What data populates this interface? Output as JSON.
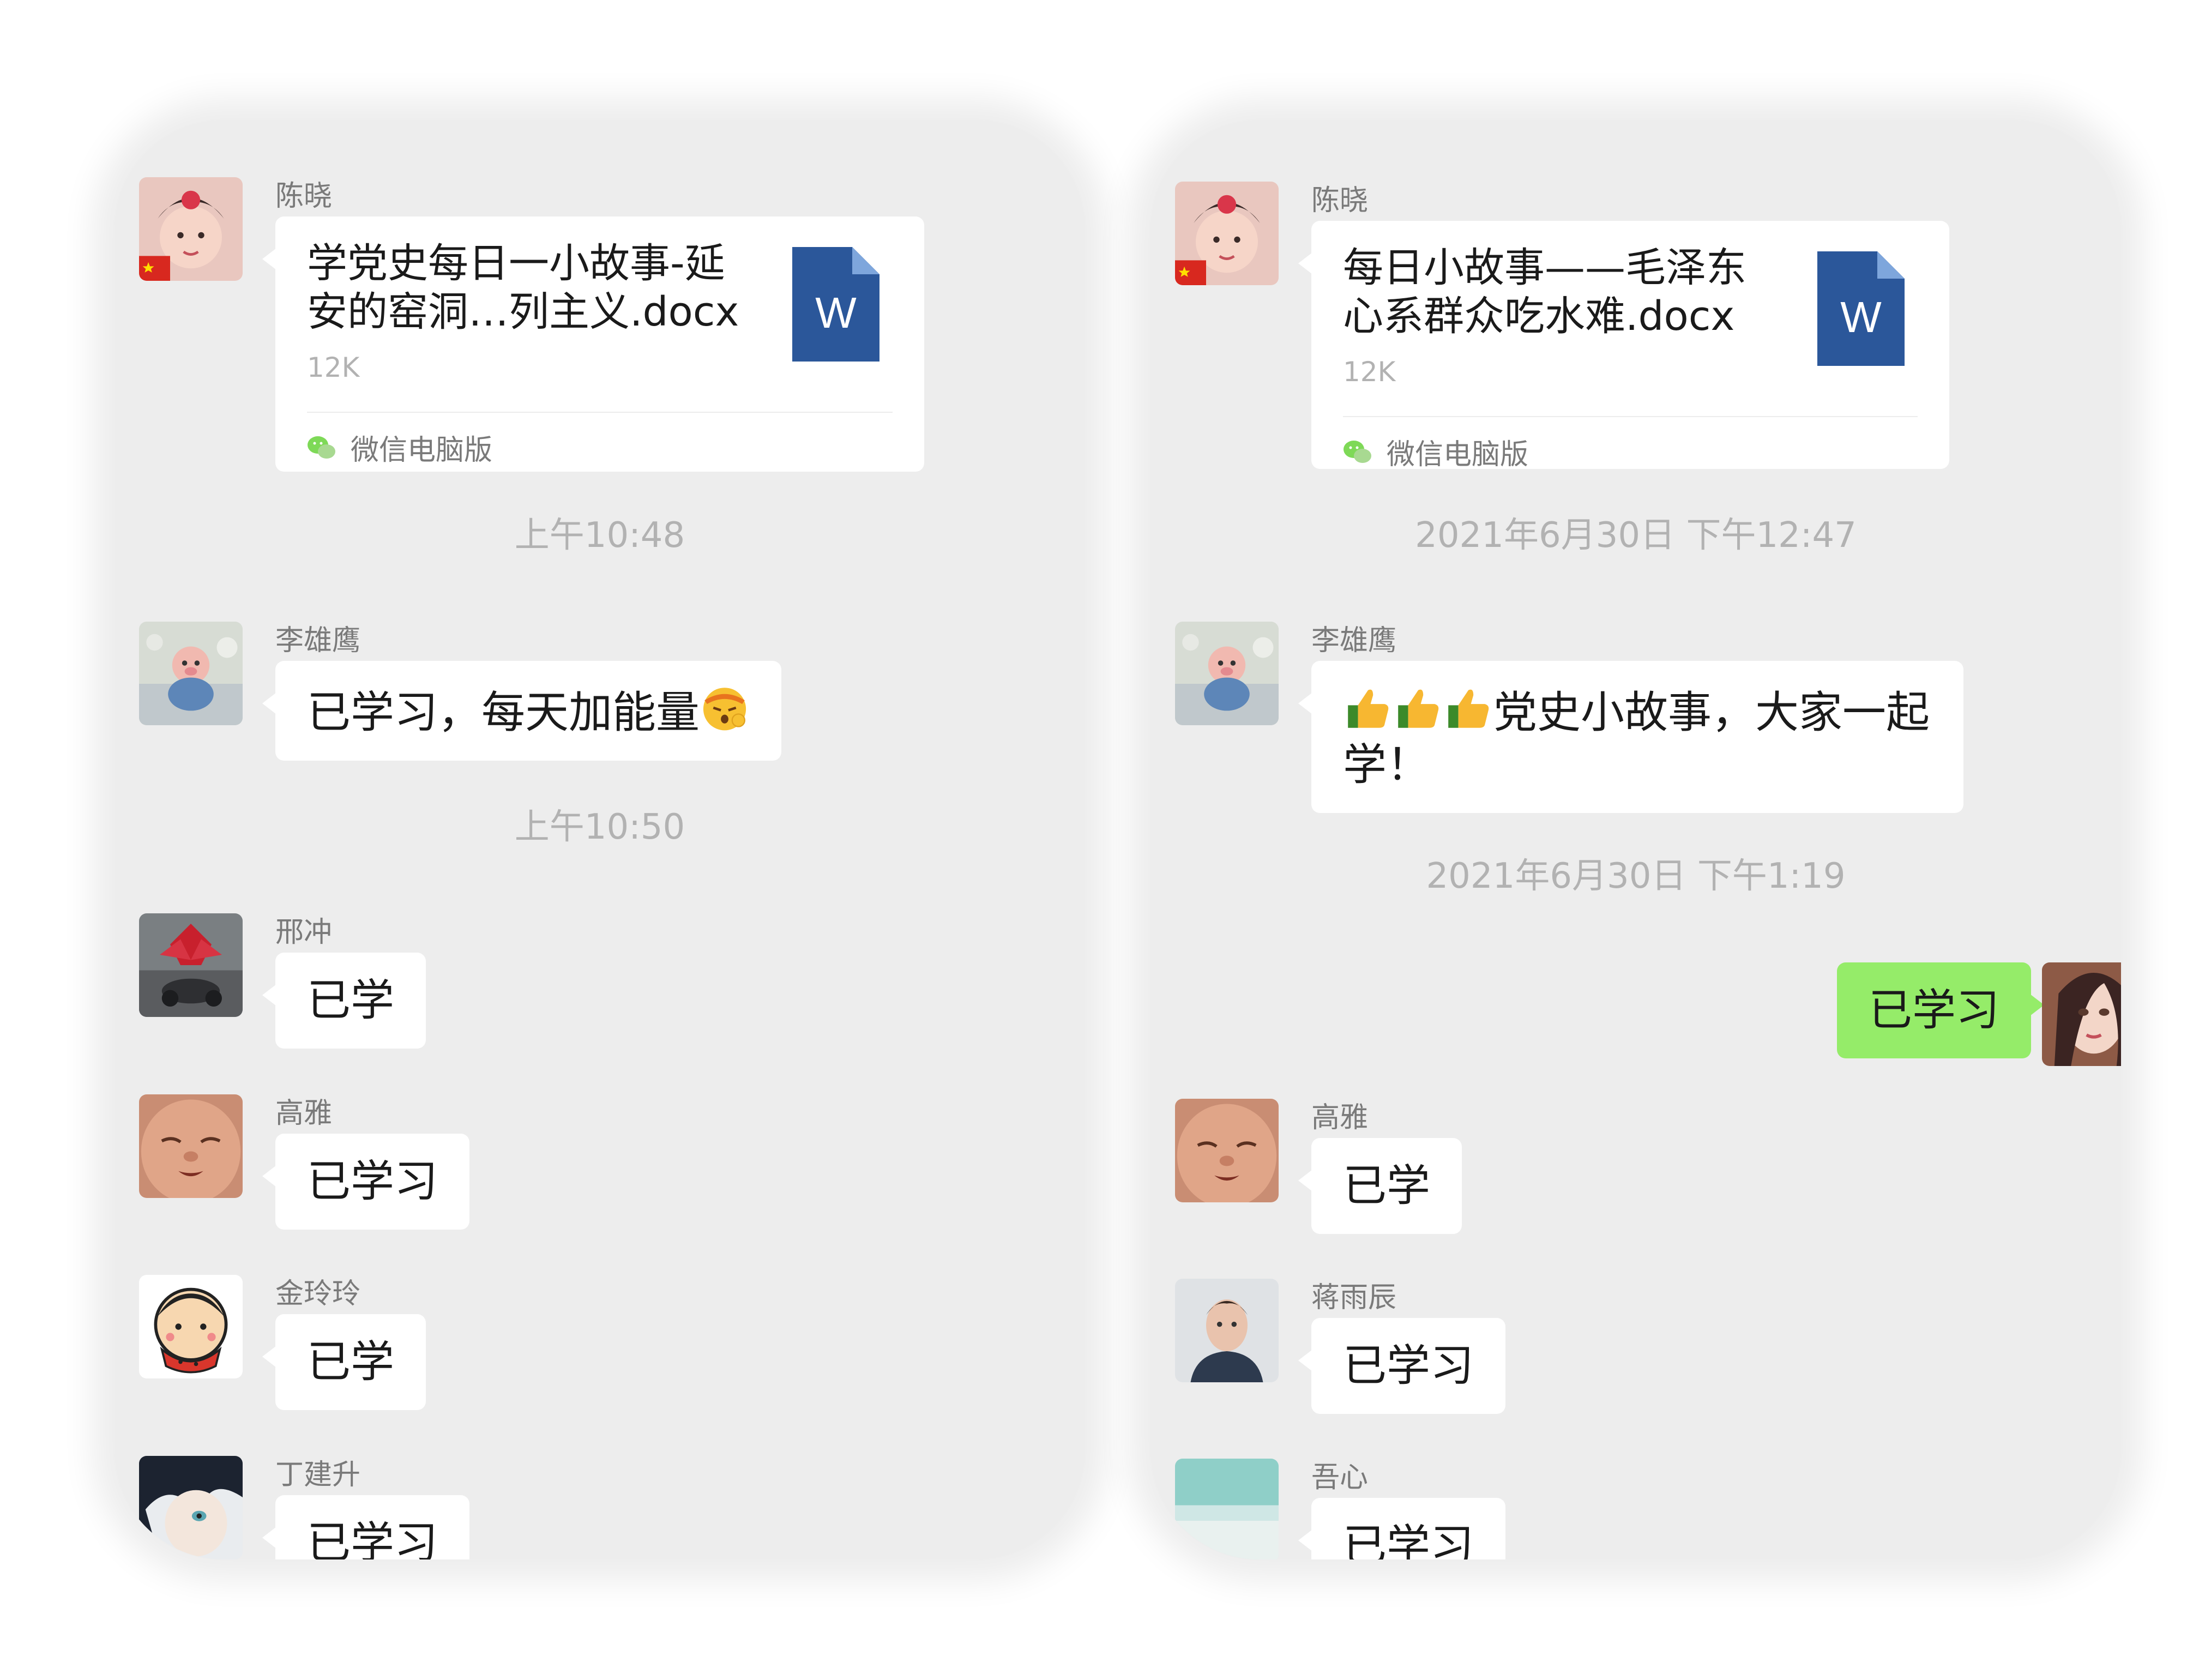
{
  "left_chat": {
    "file_message": {
      "sender": "陈晓",
      "file_name_line1": "学党史每日一小故事-延",
      "file_name_line2": "安的窑洞…列主义.docx",
      "file_size": "12K",
      "file_type_letter": "W",
      "source": "微信电脑版"
    },
    "timestamp_1": "上午10:48",
    "message_1": {
      "sender": "李雄鹰",
      "text": "已学习，每天加能量"
    },
    "timestamp_2": "上午10:50",
    "message_2": {
      "sender": "邢冲",
      "text": "已学"
    },
    "message_3": {
      "sender": "高雅",
      "text": "已学习"
    },
    "message_4": {
      "sender": "金玲玲",
      "text": "已学"
    },
    "message_5": {
      "sender": "丁建升",
      "text": "已学习"
    }
  },
  "right_chat": {
    "file_message": {
      "sender": "陈晓",
      "file_name_line1": "每日小故事——毛泽东",
      "file_name_line2": "心系群众吃水难.docx",
      "file_size": "12K",
      "file_type_letter": "W",
      "source": "微信电脑版"
    },
    "timestamp_1": "2021年6月30日 下午12:47",
    "message_1": {
      "sender": "李雄鹰",
      "text_line1": "党史小故事，大家一起",
      "text_line2": "学！"
    },
    "timestamp_2": "2021年6月30日 下午1:19",
    "my_message": {
      "text": "已学习"
    },
    "message_2": {
      "sender": "高雅",
      "text": "已学"
    },
    "message_3": {
      "sender": "蒋雨辰",
      "text": "已学习"
    },
    "message_4": {
      "sender": "吾心",
      "text": "已学习"
    }
  },
  "colors": {
    "chat_background": "#ededed",
    "bubble_other": "#ffffff",
    "bubble_mine": "#95ec69",
    "word_icon_blue": "#2b579a"
  },
  "icons": [
    "word-file-icon",
    "wechat-logo-icon",
    "thumbs-up-emoji",
    "cool-face-emoji"
  ]
}
